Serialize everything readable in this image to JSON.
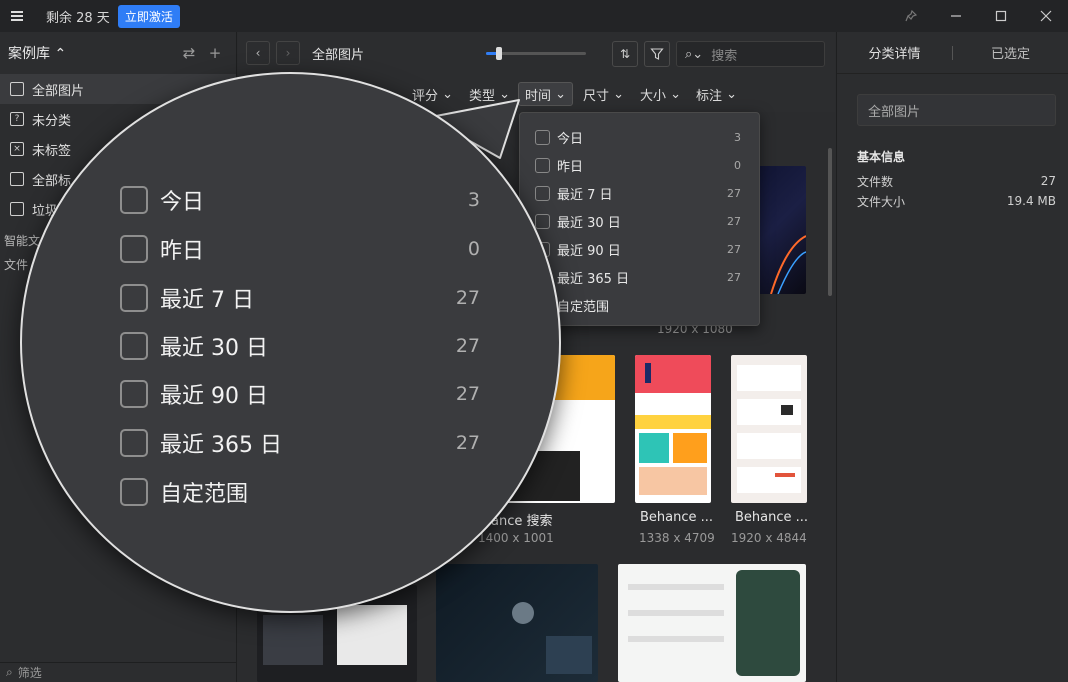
{
  "titlebar": {
    "trial_text": "剩余 28 天",
    "activate_label": "立即激活",
    "pin_icon": "pin-icon",
    "minimize_icon": "minimize-icon",
    "maximize_icon": "maximize-icon",
    "close_icon": "close-icon"
  },
  "sidebar": {
    "library_title": "案例库 ⌃",
    "items": [
      {
        "label": "全部图片",
        "icon": "images-icon",
        "active": true
      },
      {
        "label": "未分类",
        "icon": "unclassified-icon",
        "active": false
      },
      {
        "label": "未标签",
        "icon": "untagged-icon",
        "active": false
      },
      {
        "label": "全部标",
        "icon": "tags-icon",
        "active": false
      },
      {
        "label": "垃圾",
        "icon": "trash-icon",
        "active": false
      }
    ],
    "smart_folders_label": "智能文",
    "folders_label": "文件",
    "filter_placeholder": "筛选"
  },
  "toolbar": {
    "breadcrumb": "全部图片",
    "search_placeholder": "搜索",
    "zoom_fraction": 0.12
  },
  "filters": {
    "rating": "评分",
    "type": "类型",
    "time": "时间",
    "size": "尺寸",
    "filesize": "大小",
    "annotation": "标注"
  },
  "time_dropdown": [
    {
      "label": "今日",
      "count": "3"
    },
    {
      "label": "昨日",
      "count": "0"
    },
    {
      "label": "最近 7 日",
      "count": "27"
    },
    {
      "label": "最近 30 日",
      "count": "27"
    },
    {
      "label": "最近 90 日",
      "count": "27"
    },
    {
      "label": "最近 365 日",
      "count": "27"
    },
    {
      "label": "自定范围",
      "count": ""
    }
  ],
  "cards": [
    {
      "name": "",
      "size": "1920 x 1080"
    },
    {
      "name": "ance 搜索",
      "size": "1400 x 1001"
    },
    {
      "name": "Behance ...",
      "size": "1338 x 4709"
    },
    {
      "name": "Behance ...",
      "size": "1920 x 4844"
    }
  ],
  "right_panel": {
    "tab_details": "分类详情",
    "tab_selected": "已选定",
    "name_value": "全部图片",
    "section_basic": "基本信息",
    "file_count_label": "文件数",
    "file_count_value": "27",
    "file_size_label": "文件大小",
    "file_size_value": "19.4 MB"
  },
  "colors": {
    "accent": "#2f7df6",
    "background": "#2b2c2e"
  }
}
